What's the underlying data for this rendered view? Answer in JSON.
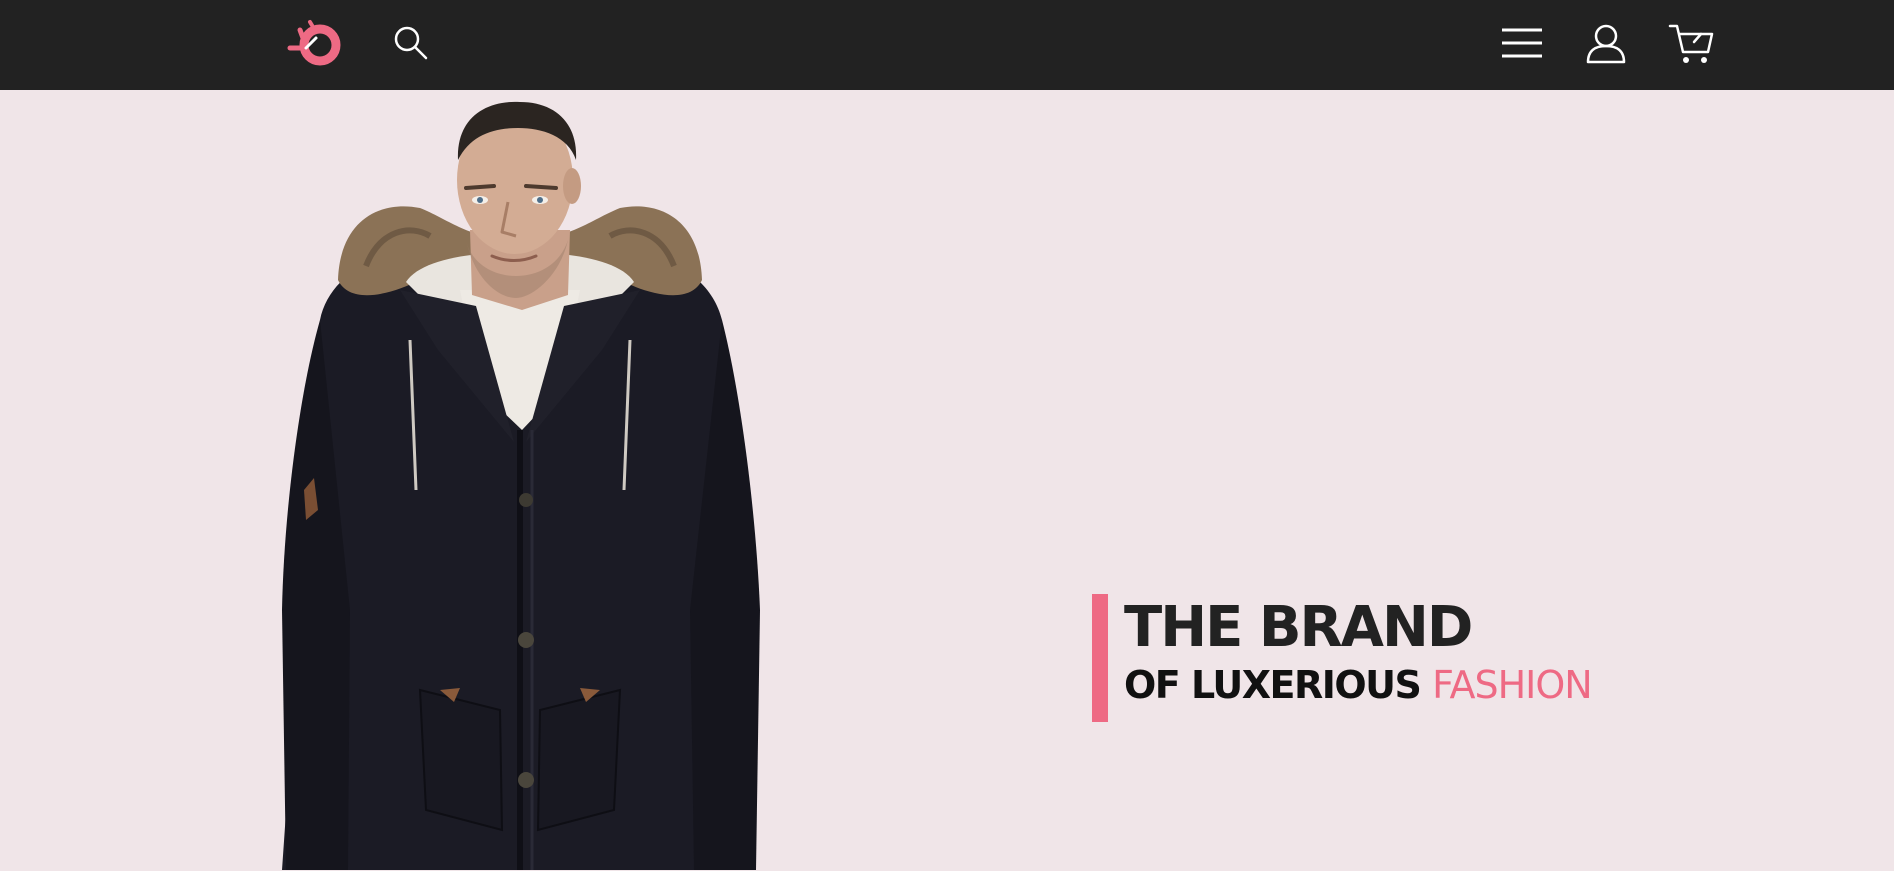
{
  "colors": {
    "header_bg": "#222222",
    "page_bg": "#f0e5e8",
    "accent": "#ee6a84",
    "icon_stroke": "#ffffff"
  },
  "header": {
    "logo_icon": "brand-logo-icon",
    "search_icon": "search-icon",
    "menu_icon": "hamburger-menu-icon",
    "user_icon": "user-icon",
    "cart_icon": "cart-icon"
  },
  "hero": {
    "image_subject": "model-in-black-parka",
    "headline": "THE BRAND",
    "subline_prefix": "OF LUXERIOUS",
    "subline_accent": "FASHION"
  }
}
